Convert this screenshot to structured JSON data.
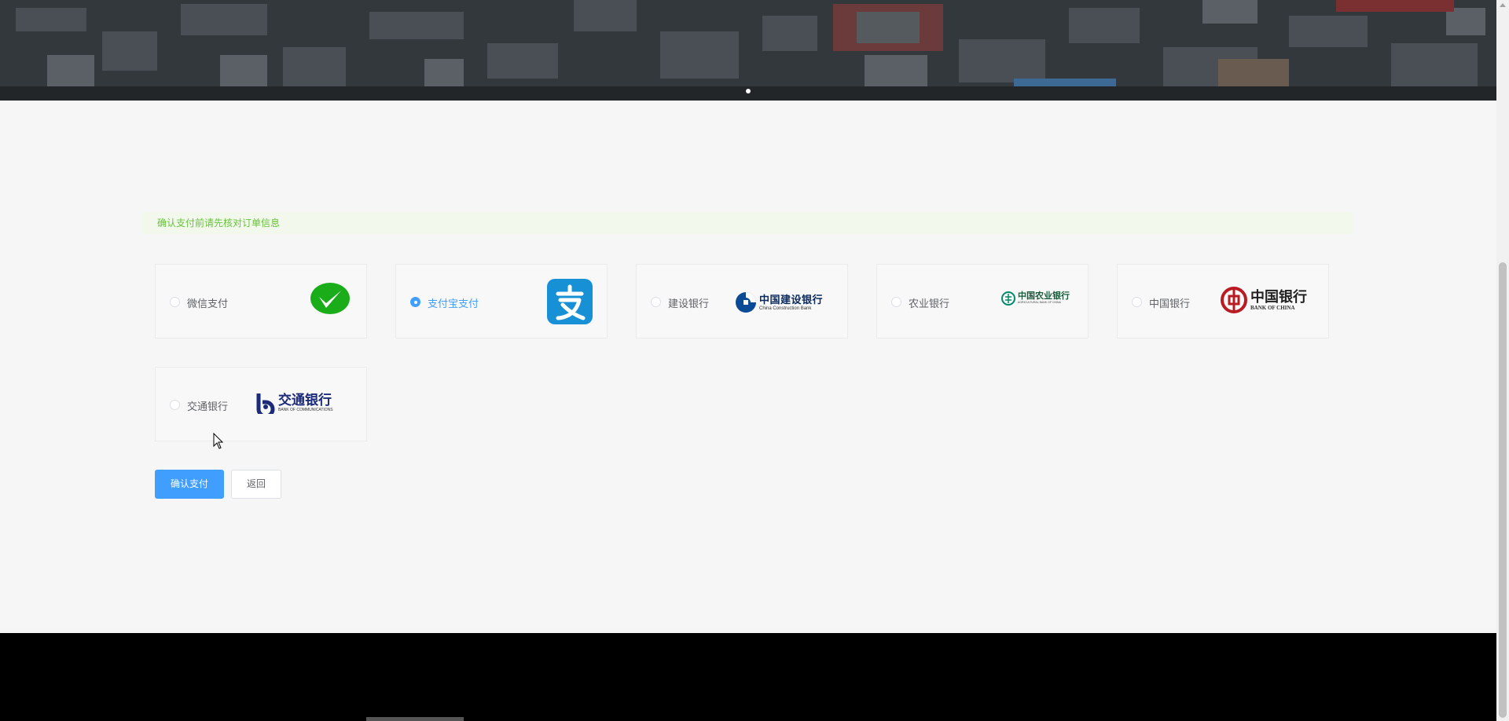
{
  "notice": {
    "text": "确认支付前请先核对订单信息"
  },
  "payment_methods": [
    {
      "label": "微信支付",
      "logo_icon": "wechat-pay-logo-icon",
      "selected": false
    },
    {
      "label": "支付宝支付",
      "logo_icon": "alipay-logo-icon",
      "selected": true
    },
    {
      "label": "建设银行",
      "logo_icon": "ccb-logo-icon",
      "selected": false,
      "logo_text": "中国建设银行",
      "logo_subtext": "China Construction Bank"
    },
    {
      "label": "农业银行",
      "logo_icon": "abc-logo-icon",
      "selected": false,
      "logo_text": "中国农业银行",
      "logo_subtext": "AGRICULTURAL BANK OF CHINA"
    },
    {
      "label": "中国银行",
      "logo_icon": "boc-logo-icon",
      "selected": false,
      "logo_text": "中国银行",
      "logo_subtext": "BANK OF CHINA"
    },
    {
      "label": "交通银行",
      "logo_icon": "bocom-logo-icon",
      "selected": false,
      "logo_text": "交通银行",
      "logo_subtext": "BANK OF COMMUNICATIONS"
    }
  ],
  "actions": {
    "confirm_label": "确认支付",
    "back_label": "返回"
  },
  "colors": {
    "primary": "#409eff",
    "notice_text": "#67c23a",
    "notice_bg": "#f2f9ec",
    "wechat": "#1aad19",
    "alipay": "#1890d6",
    "ccb": "#0b4a94",
    "abc": "#008c6a",
    "boc": "#b81c22",
    "bocom": "#1c2a7a"
  }
}
